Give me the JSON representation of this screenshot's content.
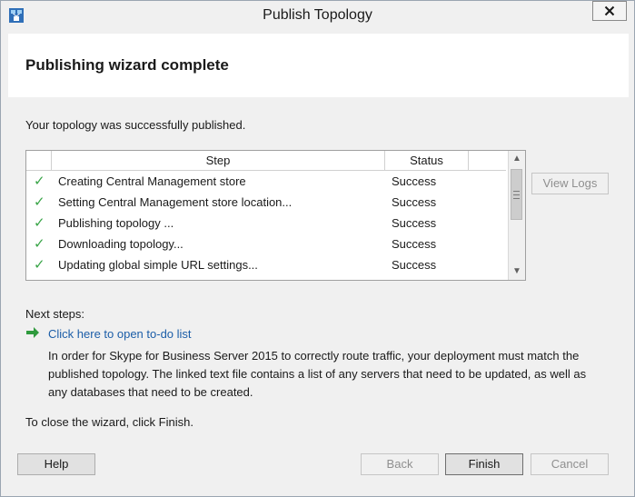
{
  "window": {
    "title": "Publish Topology",
    "close_icon": "close-x-icon",
    "app_icon": "topology-builder-icon"
  },
  "header": {
    "title": "Publishing wizard complete"
  },
  "intro_text": "Your topology was successfully published.",
  "steps_table": {
    "columns": [
      "Step",
      "Status"
    ],
    "rows": [
      {
        "step": "Creating Central Management store",
        "status": "Success"
      },
      {
        "step": "Setting Central Management store location...",
        "status": "Success"
      },
      {
        "step": "Publishing topology ...",
        "status": "Success"
      },
      {
        "step": "Downloading topology...",
        "status": "Success"
      },
      {
        "step": "Updating global simple URL settings...",
        "status": "Success"
      }
    ],
    "row_icon": "green-check-icon"
  },
  "view_logs_label": "View Logs",
  "next_steps": {
    "label": "Next steps:",
    "link_text": "Click here to open to-do list",
    "description": "In order for Skype for Business Server 2015 to correctly route traffic, your deployment must match the published topology. The linked text file contains a list of any servers that need to be updated, as well as any databases that need to be created."
  },
  "close_hint": "To close the wizard, click Finish.",
  "buttons": {
    "help": "Help",
    "back": "Back",
    "finish": "Finish",
    "cancel": "Cancel"
  },
  "colors": {
    "check": "#3aa548",
    "link": "#1c5ea8",
    "arrow": "#2f9a3d"
  }
}
